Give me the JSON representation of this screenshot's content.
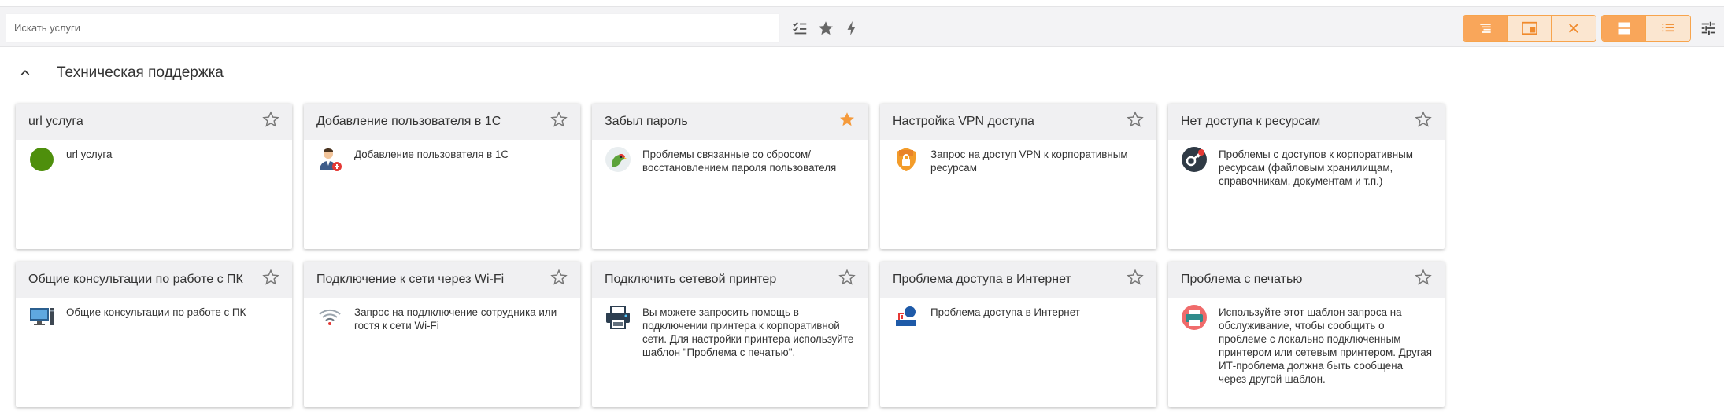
{
  "search": {
    "placeholder": "Искать услуги",
    "value": ""
  },
  "toolbar": {
    "icons": [
      "checklist-icon",
      "star-icon",
      "flash-icon"
    ],
    "view_group_1": [
      "list-view-icon",
      "popup-view-icon",
      "close-icon"
    ],
    "view_group_2": [
      "card-view-icon",
      "compact-list-icon"
    ],
    "settings_icon": "sliders-icon",
    "accent_color": "#f9a65a"
  },
  "section": {
    "title": "Техническая поддержка"
  },
  "cards": [
    {
      "title": "url услуга",
      "desc": "url услуга",
      "icon": "green-circle-icon",
      "favorite": false
    },
    {
      "title": "Добавление пользователя в 1С",
      "desc": "Добавление пользователя в 1С",
      "icon": "add-user-icon",
      "favorite": false
    },
    {
      "title": "Забыл пароль",
      "desc": "Проблемы связанные со сбросом/восстановлением пароля пользователя",
      "icon": "parrot-icon",
      "favorite": true
    },
    {
      "title": "Настройка VPN доступа",
      "desc": "Запрос на доступ VPN к корпоративным ресурсам",
      "icon": "vpn-shield-icon",
      "favorite": false
    },
    {
      "title": "Нет доступа к ресурсам",
      "desc": "Проблемы с доступов к корпоративным ресурсам (файловым хранилищам, справочникам, документам и т.п.)",
      "icon": "key-access-icon",
      "favorite": false
    },
    {
      "title": "Общие консультации по работе с ПК",
      "desc": "Общие консультации по работе с ПК",
      "icon": "computer-icon",
      "favorite": false
    },
    {
      "title": "Подключение к сети через Wi-Fi",
      "desc": "Запрос на подлключение сотрудника или гостя к сети Wi-Fi",
      "icon": "wifi-icon",
      "favorite": false
    },
    {
      "title": "Подключить сетевой принтер",
      "desc": "Вы можете запросить помощь в подключении принтера к корпоративной сети. Для настройки принтера используйте шаблон \"Проблема с печатью\".",
      "icon": "network-printer-icon",
      "favorite": false
    },
    {
      "title": "Проблема доступа в Интернет",
      "desc": "Проблема доступа в Интернет",
      "icon": "internet-access-icon",
      "favorite": false
    },
    {
      "title": "Проблема с печатью",
      "desc": "Используйте этот шаблон запроса на обслуживание, чтобы сообщить о проблеме с локально подключенным принтером или сетевым принтером. Другая ИТ-проблема должна быть сообщена через другой шаблон.",
      "icon": "printer-icon",
      "favorite": false
    }
  ]
}
